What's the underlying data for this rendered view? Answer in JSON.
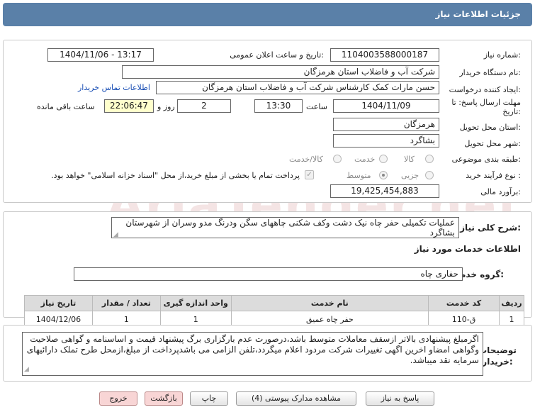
{
  "header": {
    "title": "جزئیات اطلاعات نیاز"
  },
  "watermark": "AriaTender.net",
  "form": {
    "need_number_label": "شماره نیاز:",
    "need_number": "1104003588000187",
    "announce_label": "تاریخ و ساعت اعلان عمومی:",
    "announce_value": "1404/11/06 - 13:17",
    "buyer_org_label": "نام دستگاه خریدار:",
    "buyer_org": "شرکت آب و فاضلاب استان هرمزگان",
    "creator_label": "ایجاد کننده درخواست:",
    "creator": "حسن مارات کمک کارشناس شرکت آب و فاضلاب استان هرمزگان",
    "contact_link": "اطلاعات تماس خریدار",
    "deadline_label": "مهلت ارسال پاسخ: تا تاریخ:",
    "deadline_date": "1404/11/09",
    "time_label": "ساعت",
    "deadline_time": "13:30",
    "days_value": "2",
    "days_label": "روز و",
    "remaining_time": "22:06:47",
    "remaining_label": "ساعت باقی مانده",
    "province_label": "استان محل تحویل:",
    "province": "هرمزگان",
    "city_label": "شهر محل تحویل:",
    "city": "بشاگرد",
    "category_label": "طبقه بندی موضوعی:",
    "category_options": [
      "کالا",
      "خدمت",
      "کالا/خدمت"
    ],
    "process_label": "نوع فرآیند خرید :",
    "process_options": [
      "جزیی",
      "متوسط"
    ],
    "payment_note": "پرداخت تمام یا بخشی از مبلغ خرید،از محل \"اسناد خزانه اسلامی\" خواهد بود.",
    "budget_label": "برآورد مالی:",
    "budget": "19,425,454,883"
  },
  "description": {
    "label": "شرح کلی نیاز:",
    "text": "عملیات تکمیلی حفر چاه نیک دشت وکف شکنی چاههای سگن ودرنگ مدو وسران از شهرستان بشاگرد"
  },
  "services": {
    "section_title": "اطلاعات خدمات مورد نیاز",
    "group_label": "گروه خدمت:",
    "group_value": "حفاری چاه",
    "columns": [
      "ردیف",
      "کد خدمت",
      "نام خدمت",
      "واحد اندازه گیری",
      "تعداد / مقدار",
      "تاریخ نیاز"
    ],
    "rows": [
      [
        "1",
        "ق-110",
        "حفر چاه عمیق",
        "1",
        "1",
        "1404/12/06"
      ]
    ]
  },
  "buyer_notes": {
    "label": "توضیحات خریدار:",
    "text": "اگرمبلغ پیشنهادی بالاتر ازسقف معاملات متوسط باشد،درصورت عدم بارگزاری برگ پیشنهاد قیمت و اساسنامه و گواهی صلاحیت وگواهی امضاو اخرین اگهی تغییرات شرکت مردود اعلام میگردد،تلفن الزامی می باشدپرداخت از مبلغ،ازمحل طرح تملک دارائیهای سرمایه نقد میباشد."
  },
  "buttons": {
    "respond": "پاسخ به نیاز",
    "view_docs": "مشاهده مدارک پیوستی (4)",
    "print": "چاپ",
    "back": "بازگشت",
    "exit": "خروج"
  }
}
